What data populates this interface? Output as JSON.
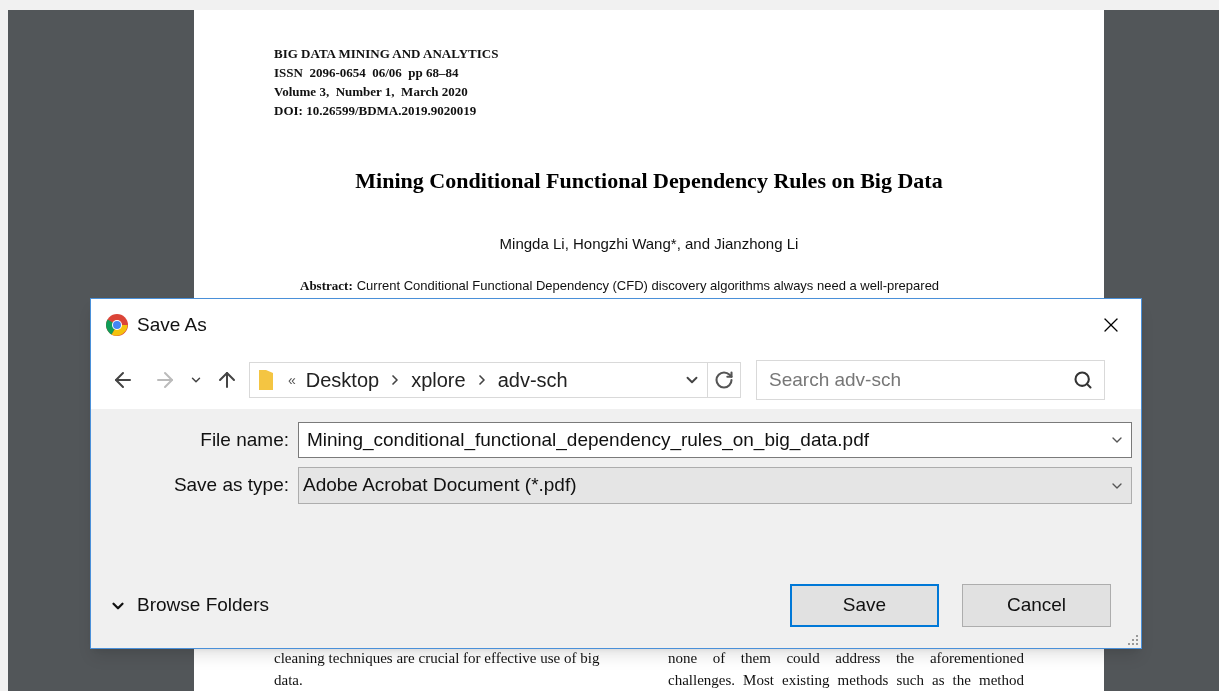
{
  "document": {
    "journal_lines": [
      "BIG DATA MINING AND ANALYTICS",
      "ISSN  2096-0654  06/06  pp 68–84",
      "Volume 3,  Number 1,  March 2020",
      "DOI: 10.26599/BDMA.2019.9020019"
    ],
    "title": "Mining Conditional Functional Dependency Rules on Big Data",
    "authors": "Mingda Li, Hongzhi Wang*, and Jianzhong Li",
    "abstract_label": "Abstract:",
    "abstract_text": "Current Conditional Functional Dependency (CFD) discovery algorithms always need a well-prepared",
    "column_1_lines": [
      "cleaning techniques are crucial for effective use of big",
      "data."
    ],
    "column_2_lines": [
      "none of them could address the aforementioned",
      "challenges. Most existing methods such as the method"
    ]
  },
  "dialog": {
    "title": "Save As",
    "path_prefix": "«",
    "breadcrumbs": [
      "Desktop",
      "xplore",
      "adv-sch"
    ],
    "search": {
      "placeholder": "Search adv-sch"
    },
    "fields": [
      {
        "label": "File name:",
        "value": "Mining_conditional_functional_dependency_rules_on_big_data.pdf",
        "kind": "combo"
      },
      {
        "label": "Save as type:",
        "value": "Adobe Acrobat Document (*.pdf)",
        "kind": "select"
      }
    ],
    "browse_folders": {
      "label": "Browse Folders",
      "expanded": false
    },
    "buttons": [
      {
        "label": "Save",
        "default": true
      },
      {
        "label": "Cancel",
        "default": false
      }
    ]
  }
}
